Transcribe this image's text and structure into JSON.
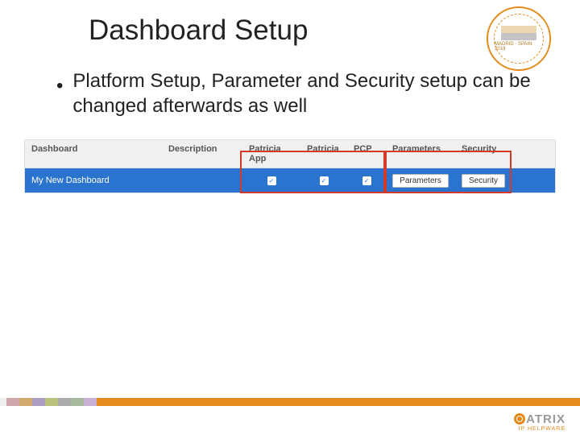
{
  "title": "Dashboard Setup",
  "bullet": "Platform Setup, Parameter and Security setup can be changed afterwards as well",
  "table": {
    "headers": {
      "dashboard": "Dashboard",
      "description": "Description",
      "patricia_app": "Patricia App",
      "patricia": "Patricia",
      "pcp": "PCP",
      "parameters": "Parameters",
      "security": "Security"
    },
    "row": {
      "dashboard": "My New Dashboard",
      "description": "",
      "patricia_app_checked": "✓",
      "patricia_checked": "✓",
      "pcp_checked": "✓",
      "parameters_btn": "Parameters",
      "security_btn": "Security"
    }
  },
  "badge": {
    "line1": "MADRID · SPAIN 2019"
  },
  "brand": {
    "name": "ATRIX",
    "sub": "IP HELPWARE"
  }
}
